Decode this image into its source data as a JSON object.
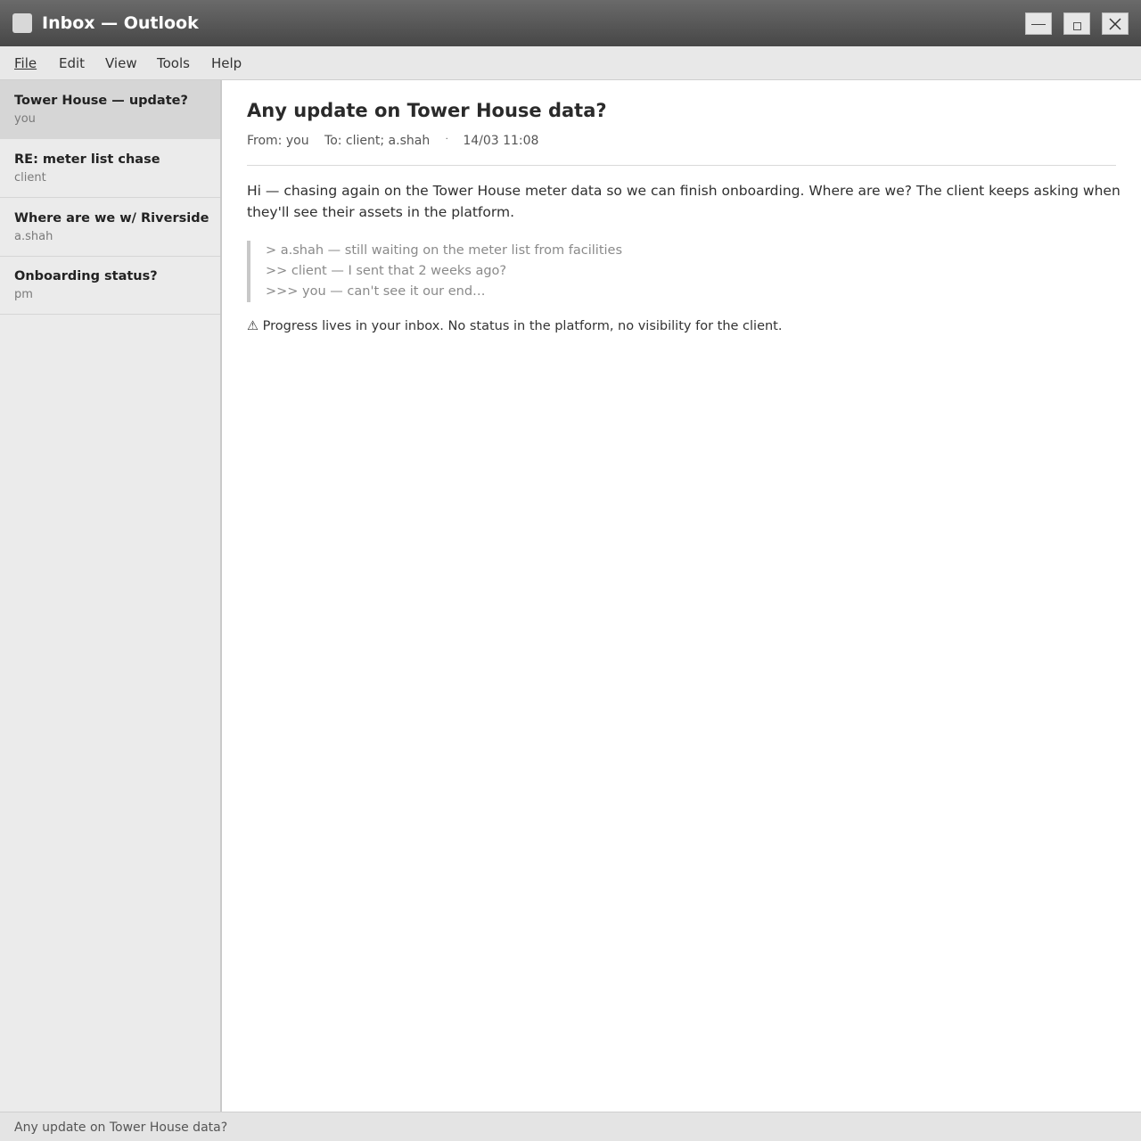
{
  "window": {
    "title": "Inbox — Outlook"
  },
  "menu": [
    "File",
    "Edit",
    "View",
    "Tools",
    "Help"
  ],
  "sidebar": {
    "items": [
      {
        "subject": "Tower House — update?",
        "sender": "you",
        "selected": true
      },
      {
        "subject": "RE: meter list chase",
        "sender": "client",
        "selected": false
      },
      {
        "subject": "Where are we w/ Riverside",
        "sender": "a.shah",
        "selected": false
      },
      {
        "subject": "Onboarding status?",
        "sender": "pm",
        "selected": false
      }
    ]
  },
  "message": {
    "subject": "Any update on Tower House data?",
    "from": "From: you",
    "to": "To: client; a.shah",
    "separator": "·",
    "date": "14/03 11:08",
    "body": "Hi — chasing again on the Tower House meter data so we can finish onboarding. Where are we? The client keeps asking when they'll see their assets in the platform.",
    "quotes": [
      "> a.shah — still waiting on the meter list from facilities",
      ">> client — I sent that 2 weeks ago?",
      ">>> you — can't see it our end…"
    ],
    "warning": "⚠ Progress lives in your inbox. No status in the platform, no visibility for the client."
  },
  "status": {
    "text": "Any update on Tower House data?"
  },
  "colors": {
    "titlebar": "#4f4f4f",
    "sidebar": "#ebebeb",
    "selected_item": "#d6d6d6"
  }
}
